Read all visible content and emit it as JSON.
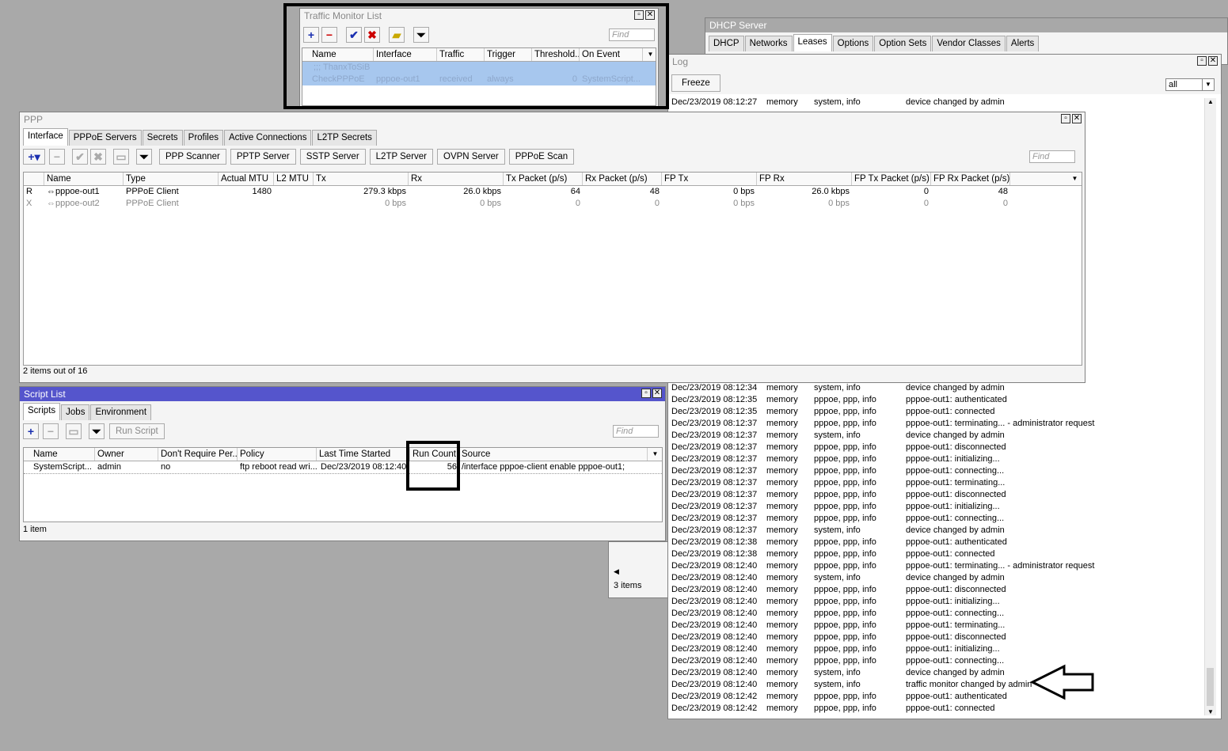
{
  "dhcp": {
    "title": "DHCP Server",
    "tabs": [
      "DHCP",
      "Networks",
      "Leases",
      "Options",
      "Option Sets",
      "Vendor Classes",
      "Alerts"
    ],
    "selected_tab": "Leases"
  },
  "back_window": {
    "status": "3 items"
  },
  "log": {
    "title": "Log",
    "freeze": "Freeze",
    "filter": "all",
    "entries_top": [
      {
        "time": "Dec/23/2019 08:12:27",
        "buffer": "memory",
        "topics": "system, info",
        "message": "device changed by admin"
      }
    ],
    "entries": [
      {
        "time": "Dec/23/2019 08:12:34",
        "buffer": "memory",
        "topics": "system, info",
        "message": "device changed by admin"
      },
      {
        "time": "Dec/23/2019 08:12:35",
        "buffer": "memory",
        "topics": "pppoe, ppp, info",
        "message": "pppoe-out1: authenticated"
      },
      {
        "time": "Dec/23/2019 08:12:35",
        "buffer": "memory",
        "topics": "pppoe, ppp, info",
        "message": "pppoe-out1: connected"
      },
      {
        "time": "Dec/23/2019 08:12:37",
        "buffer": "memory",
        "topics": "pppoe, ppp, info",
        "message": "pppoe-out1: terminating... - administrator request"
      },
      {
        "time": "Dec/23/2019 08:12:37",
        "buffer": "memory",
        "topics": "system, info",
        "message": "device changed by admin"
      },
      {
        "time": "Dec/23/2019 08:12:37",
        "buffer": "memory",
        "topics": "pppoe, ppp, info",
        "message": "pppoe-out1: disconnected"
      },
      {
        "time": "Dec/23/2019 08:12:37",
        "buffer": "memory",
        "topics": "pppoe, ppp, info",
        "message": "pppoe-out1: initializing..."
      },
      {
        "time": "Dec/23/2019 08:12:37",
        "buffer": "memory",
        "topics": "pppoe, ppp, info",
        "message": "pppoe-out1: connecting..."
      },
      {
        "time": "Dec/23/2019 08:12:37",
        "buffer": "memory",
        "topics": "pppoe, ppp, info",
        "message": "pppoe-out1: terminating..."
      },
      {
        "time": "Dec/23/2019 08:12:37",
        "buffer": "memory",
        "topics": "pppoe, ppp, info",
        "message": "pppoe-out1: disconnected"
      },
      {
        "time": "Dec/23/2019 08:12:37",
        "buffer": "memory",
        "topics": "pppoe, ppp, info",
        "message": "pppoe-out1: initializing..."
      },
      {
        "time": "Dec/23/2019 08:12:37",
        "buffer": "memory",
        "topics": "pppoe, ppp, info",
        "message": "pppoe-out1: connecting..."
      },
      {
        "time": "Dec/23/2019 08:12:37",
        "buffer": "memory",
        "topics": "system, info",
        "message": "device changed by admin"
      },
      {
        "time": "Dec/23/2019 08:12:38",
        "buffer": "memory",
        "topics": "pppoe, ppp, info",
        "message": "pppoe-out1: authenticated"
      },
      {
        "time": "Dec/23/2019 08:12:38",
        "buffer": "memory",
        "topics": "pppoe, ppp, info",
        "message": "pppoe-out1: connected"
      },
      {
        "time": "Dec/23/2019 08:12:40",
        "buffer": "memory",
        "topics": "pppoe, ppp, info",
        "message": "pppoe-out1: terminating... - administrator request"
      },
      {
        "time": "Dec/23/2019 08:12:40",
        "buffer": "memory",
        "topics": "system, info",
        "message": "device changed by admin"
      },
      {
        "time": "Dec/23/2019 08:12:40",
        "buffer": "memory",
        "topics": "pppoe, ppp, info",
        "message": "pppoe-out1: disconnected"
      },
      {
        "time": "Dec/23/2019 08:12:40",
        "buffer": "memory",
        "topics": "pppoe, ppp, info",
        "message": "pppoe-out1: initializing..."
      },
      {
        "time": "Dec/23/2019 08:12:40",
        "buffer": "memory",
        "topics": "pppoe, ppp, info",
        "message": "pppoe-out1: connecting..."
      },
      {
        "time": "Dec/23/2019 08:12:40",
        "buffer": "memory",
        "topics": "pppoe, ppp, info",
        "message": "pppoe-out1: terminating..."
      },
      {
        "time": "Dec/23/2019 08:12:40",
        "buffer": "memory",
        "topics": "pppoe, ppp, info",
        "message": "pppoe-out1: disconnected"
      },
      {
        "time": "Dec/23/2019 08:12:40",
        "buffer": "memory",
        "topics": "pppoe, ppp, info",
        "message": "pppoe-out1: initializing..."
      },
      {
        "time": "Dec/23/2019 08:12:40",
        "buffer": "memory",
        "topics": "pppoe, ppp, info",
        "message": "pppoe-out1: connecting..."
      },
      {
        "time": "Dec/23/2019 08:12:40",
        "buffer": "memory",
        "topics": "system, info",
        "message": "device changed by admin"
      },
      {
        "time": "Dec/23/2019 08:12:40",
        "buffer": "memory",
        "topics": "system, info",
        "message": "traffic monitor changed by admin"
      },
      {
        "time": "Dec/23/2019 08:12:42",
        "buffer": "memory",
        "topics": "pppoe, ppp, info",
        "message": "pppoe-out1: authenticated"
      },
      {
        "time": "Dec/23/2019 08:12:42",
        "buffer": "memory",
        "topics": "pppoe, ppp, info",
        "message": "pppoe-out1: connected"
      }
    ]
  },
  "traffic_monitor": {
    "title": "Traffic Monitor List",
    "find_placeholder": "Find",
    "columns": [
      "Name",
      "Interface",
      "Traffic",
      "Trigger",
      "Threshold...",
      "On Event"
    ],
    "comment": ";;; ThanxToSiB",
    "row": {
      "name": "CheckPPPoE",
      "interface": "pppoe-out1",
      "traffic": "received",
      "trigger": "always",
      "threshold": "0",
      "on_event": "SystemScript..."
    }
  },
  "ppp": {
    "title": "PPP",
    "tabs": [
      "Interface",
      "PPPoE Servers",
      "Secrets",
      "Profiles",
      "Active Connections",
      "L2TP Secrets"
    ],
    "buttons": [
      "PPP Scanner",
      "PPTP Server",
      "SSTP Server",
      "L2TP Server",
      "OVPN Server",
      "PPPoE Scan"
    ],
    "find_placeholder": "Find",
    "columns": [
      "",
      "Name",
      "Type",
      "Actual MTU",
      "L2 MTU",
      "Tx",
      "Rx",
      "Tx Packet (p/s)",
      "Rx Packet (p/s)",
      "FP Tx",
      "FP Rx",
      "FP Tx Packet (p/s)",
      "FP Rx Packet (p/s)"
    ],
    "rows": [
      {
        "flag": "R",
        "name": "pppoe-out1",
        "type": "PPPoE Client",
        "mtu": "1480",
        "l2mtu": "",
        "tx": "279.3 kbps",
        "rx": "26.0 kbps",
        "txp": "64",
        "rxp": "48",
        "fptx": "0 bps",
        "fprx": "26.0 kbps",
        "fptxp": "0",
        "fprxp": "48"
      },
      {
        "flag": "X",
        "name": "pppoe-out2",
        "type": "PPPoE Client",
        "mtu": "",
        "l2mtu": "",
        "tx": "0 bps",
        "rx": "0 bps",
        "txp": "0",
        "rxp": "0",
        "fptx": "0 bps",
        "fprx": "0 bps",
        "fptxp": "0",
        "fprxp": "0"
      }
    ],
    "status": "2 items out of 16"
  },
  "script_list": {
    "title": "Script List",
    "tabs": [
      "Scripts",
      "Jobs",
      "Environment"
    ],
    "run_script": "Run Script",
    "find_placeholder": "Find",
    "columns": [
      "Name",
      "Owner",
      "Don't Require Per...",
      "Policy",
      "Last Time Started",
      "Run Count",
      "Source"
    ],
    "row": {
      "name": "SystemScript...",
      "owner": "admin",
      "dont_require": "no",
      "policy": "ftp reboot read wri...",
      "last_started": "Dec/23/2019 08:12:40",
      "run_count": "56",
      "source": "/interface pppoe-client enable pppoe-out1;"
    },
    "status": "1 item"
  },
  "colors": {
    "active_title": "#5555cc",
    "inactive_title": "#a8a8a8",
    "highlight_row": "#a7c7ee",
    "desktop": "#a9a9a9"
  }
}
